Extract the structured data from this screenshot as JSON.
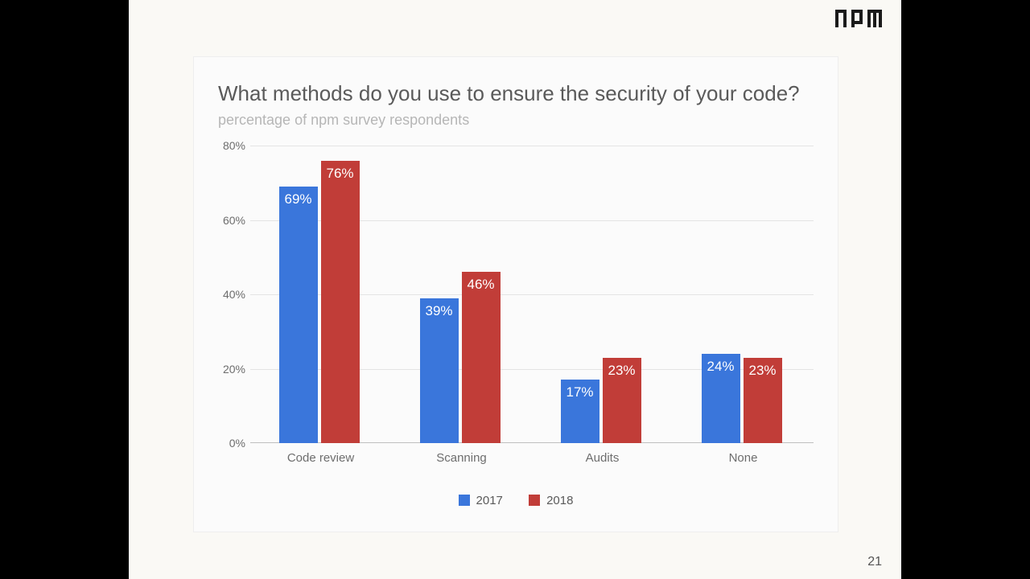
{
  "logo": "npm",
  "page_number": "21",
  "chart_data": {
    "type": "bar",
    "title": "What methods do you use to ensure the security of your code?",
    "subtitle": "percentage of npm survey respondents",
    "categories": [
      "Code review",
      "Scanning",
      "Audits",
      "None"
    ],
    "series": [
      {
        "name": "2017",
        "values": [
          69,
          39,
          17,
          24
        ],
        "color": "#3a76db"
      },
      {
        "name": "2018",
        "values": [
          76,
          46,
          23,
          23
        ],
        "color": "#c13d38"
      }
    ],
    "ylabel": "",
    "xlabel": "",
    "ylim": [
      0,
      80
    ],
    "y_ticks": [
      0,
      20,
      40,
      60,
      80
    ],
    "y_tick_labels": [
      "0%",
      "20%",
      "40%",
      "60%",
      "80%"
    ],
    "value_suffix": "%",
    "legend_position": "bottom",
    "grid": true
  }
}
